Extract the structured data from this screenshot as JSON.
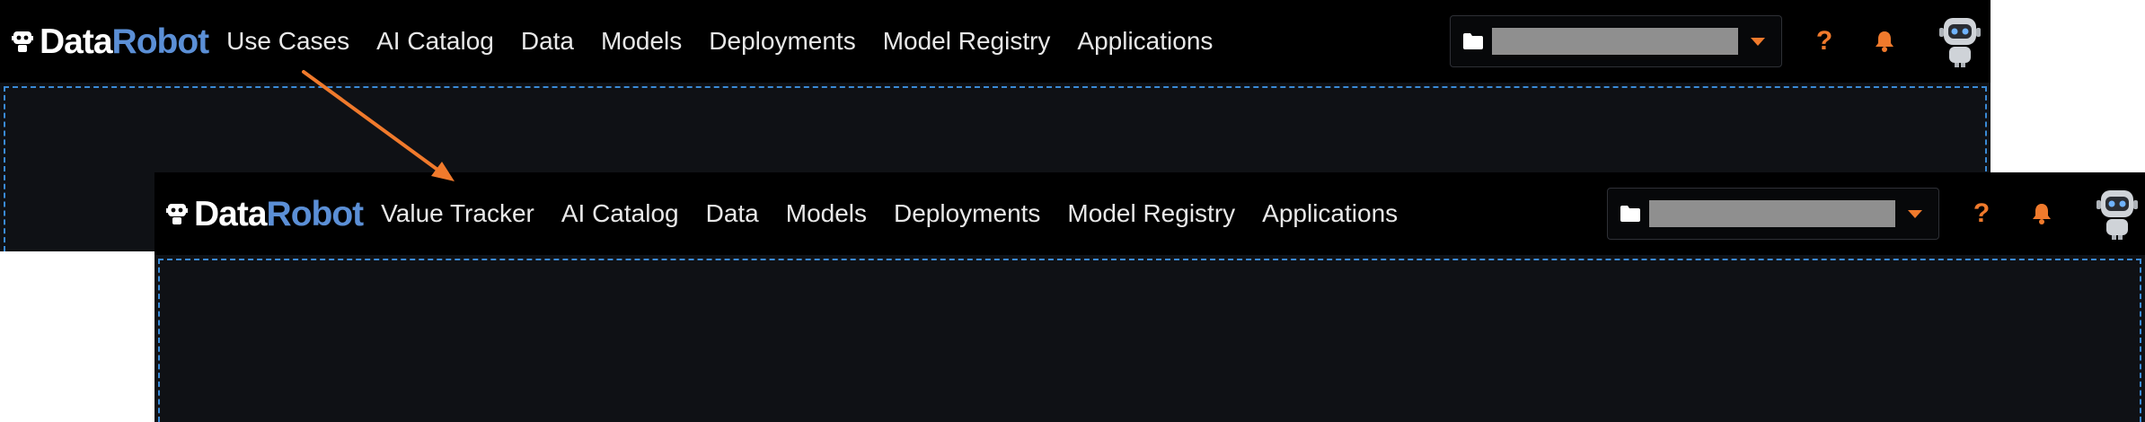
{
  "before": {
    "logo": {
      "part_a": "Data",
      "part_b": "Robot"
    },
    "nav": [
      "Use Cases",
      "AI Catalog",
      "Data",
      "Models",
      "Deployments",
      "Model Registry",
      "Applications"
    ]
  },
  "after": {
    "logo": {
      "part_a": "Data",
      "part_b": "Robot"
    },
    "nav": [
      "Value Tracker",
      "AI Catalog",
      "Data",
      "Models",
      "Deployments",
      "Model Registry",
      "Applications"
    ]
  },
  "colors": {
    "accent": "#f07a2c",
    "brand_blue": "#5b8fd6",
    "topbar_bg": "#000000",
    "content_bg": "#0f1115",
    "dashed_border": "#3a8ad6"
  },
  "icons": [
    "datarobot-logo-icon",
    "folder-icon",
    "caret-down-icon",
    "help-icon",
    "bell-icon",
    "robot-avatar-icon",
    "arrow-annotation"
  ]
}
